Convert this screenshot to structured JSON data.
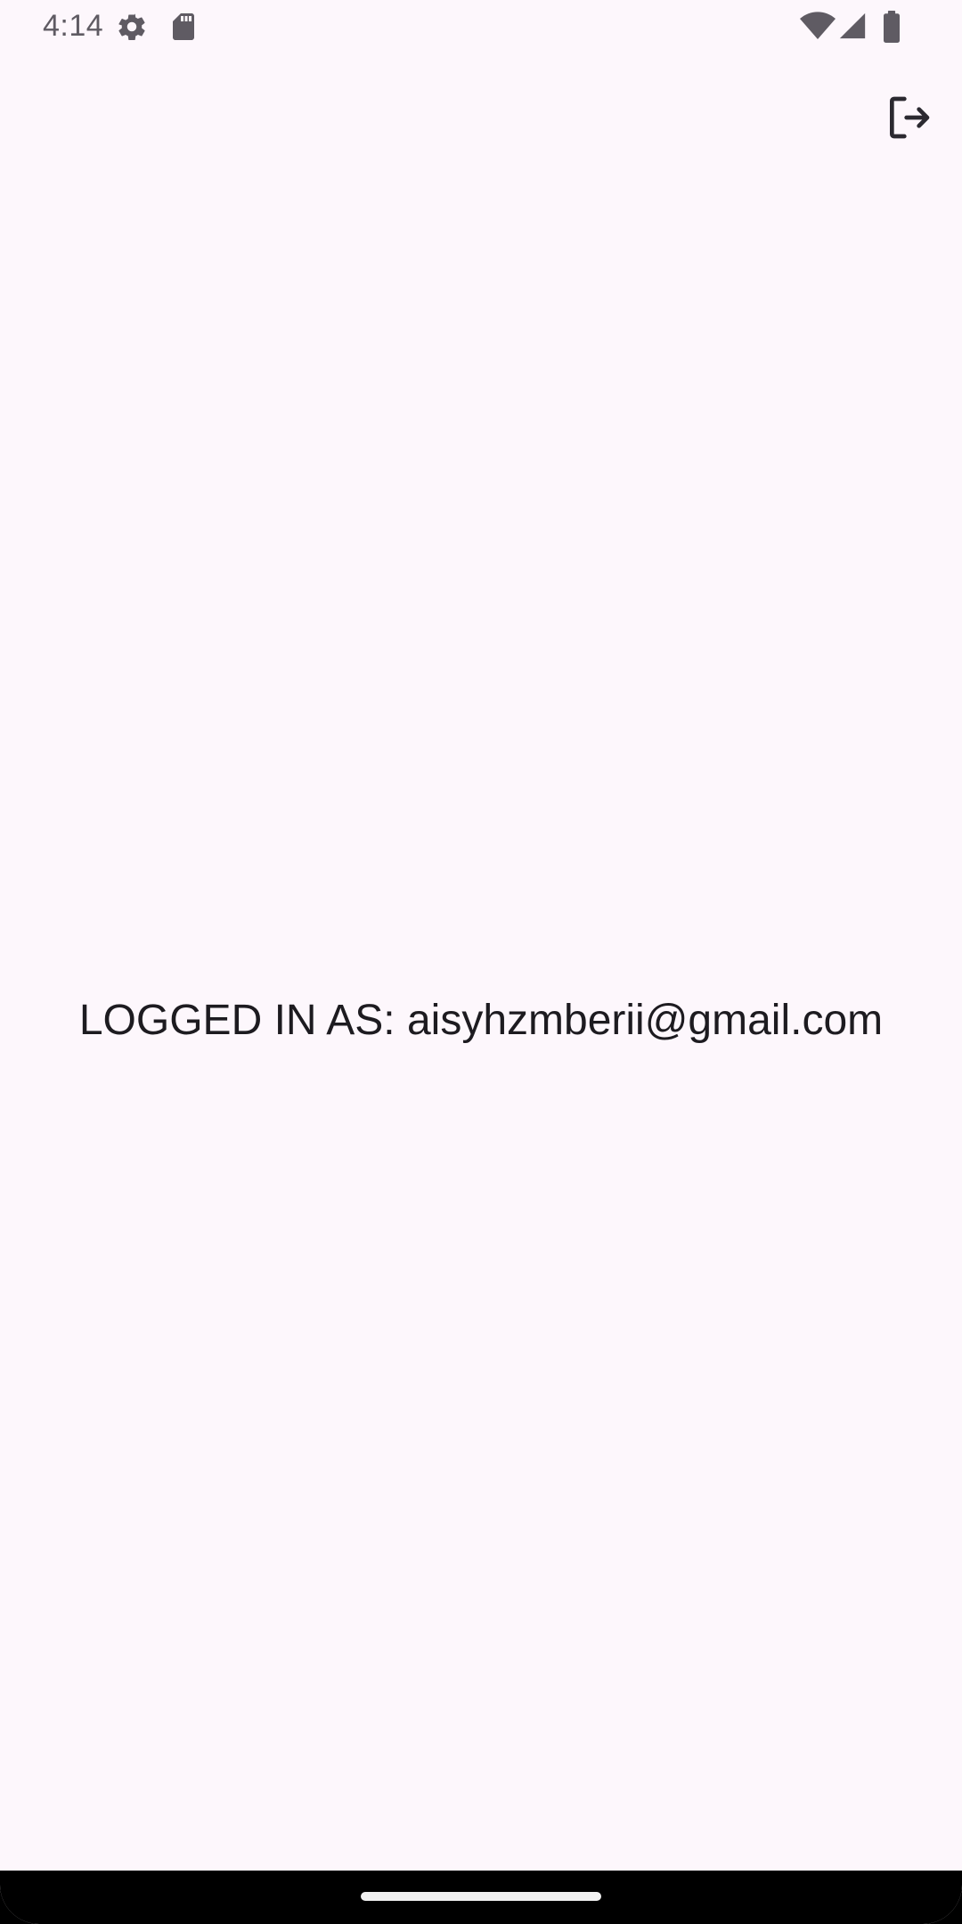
{
  "status_bar": {
    "time": "4:14",
    "icons": [
      "settings-gear-icon",
      "sd-card-icon",
      "wifi-icon",
      "cell-signal-icon",
      "battery-icon"
    ]
  },
  "toolbar": {
    "logout_icon": "logout-icon"
  },
  "main": {
    "logged_in_text": "LOGGED IN AS: aisyhzmberii@gmail.com"
  },
  "colors": {
    "background": "#FDF7FC",
    "text": "#1D1B20",
    "status_icons": "#5F5B63"
  }
}
